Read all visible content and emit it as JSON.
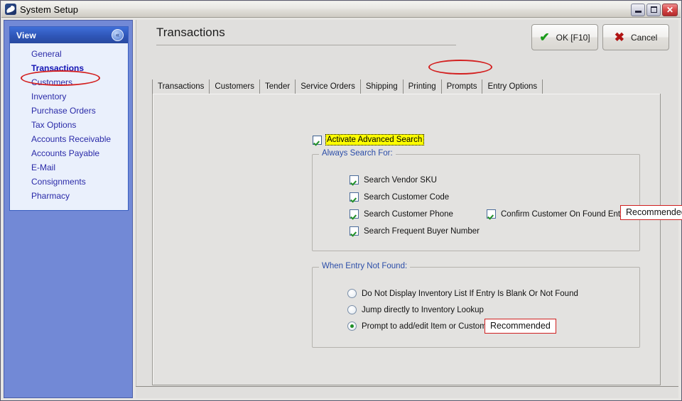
{
  "window": {
    "title": "System Setup",
    "icon": "app-logo-icon",
    "controls": {
      "minimize": "minimize-icon",
      "maximize": "maximize-icon",
      "close": "✕"
    }
  },
  "sidebar": {
    "panel_title": "View",
    "collapse_icon": "«",
    "items": [
      {
        "label": "General",
        "selected": false
      },
      {
        "label": "Transactions",
        "selected": true
      },
      {
        "label": "Customers",
        "selected": false
      },
      {
        "label": "Inventory",
        "selected": false
      },
      {
        "label": "Purchase Orders",
        "selected": false
      },
      {
        "label": "Tax Options",
        "selected": false
      },
      {
        "label": "Accounts Receivable",
        "selected": false
      },
      {
        "label": "Accounts Payable",
        "selected": false
      },
      {
        "label": "E-Mail",
        "selected": false
      },
      {
        "label": "Consignments",
        "selected": false
      },
      {
        "label": "Pharmacy",
        "selected": false
      }
    ]
  },
  "header": {
    "page_title": "Transactions",
    "ok_button": "OK [F10]",
    "ok_icon": "✔",
    "cancel_button": "Cancel",
    "cancel_icon": "✖"
  },
  "tabs": [
    {
      "label": "Transactions",
      "active": false
    },
    {
      "label": "Customers",
      "active": false
    },
    {
      "label": "Tender",
      "active": false
    },
    {
      "label": "Service Orders",
      "active": false
    },
    {
      "label": "Shipping",
      "active": false
    },
    {
      "label": "Printing",
      "active": false
    },
    {
      "label": "Prompts",
      "active": false
    },
    {
      "label": "Entry Options",
      "active": true
    }
  ],
  "main": {
    "activate_advanced_search": {
      "label": "Activate Advanced Search",
      "checked": true,
      "highlight_color": "#ffff00"
    },
    "always_search_for": {
      "legend": "Always Search For:",
      "options": [
        {
          "label": "Search Vendor SKU",
          "checked": true
        },
        {
          "label": "Search Customer Code",
          "checked": true
        },
        {
          "label": "Search Customer Phone",
          "checked": true
        },
        {
          "label": "Search Frequent Buyer Number",
          "checked": true
        }
      ],
      "side_option": {
        "label": "Confirm Customer On Found Entry",
        "checked": true
      },
      "side_badge": "Recommended"
    },
    "when_entry_not_found": {
      "legend": "When Entry Not Found:",
      "options": [
        {
          "label": "Do Not Display Inventory List If Entry Is Blank Or Not Found",
          "selected": false
        },
        {
          "label": "Jump directly to Inventory Lookup",
          "selected": false
        },
        {
          "label": "Prompt to add/edit Item or Customer",
          "selected": true
        }
      ],
      "badge": "Recommended"
    }
  },
  "annotations": {
    "color": "#d31f1f",
    "ellipse_sidebar_target": "Transactions",
    "ellipse_tab_target": "Entry Options"
  }
}
